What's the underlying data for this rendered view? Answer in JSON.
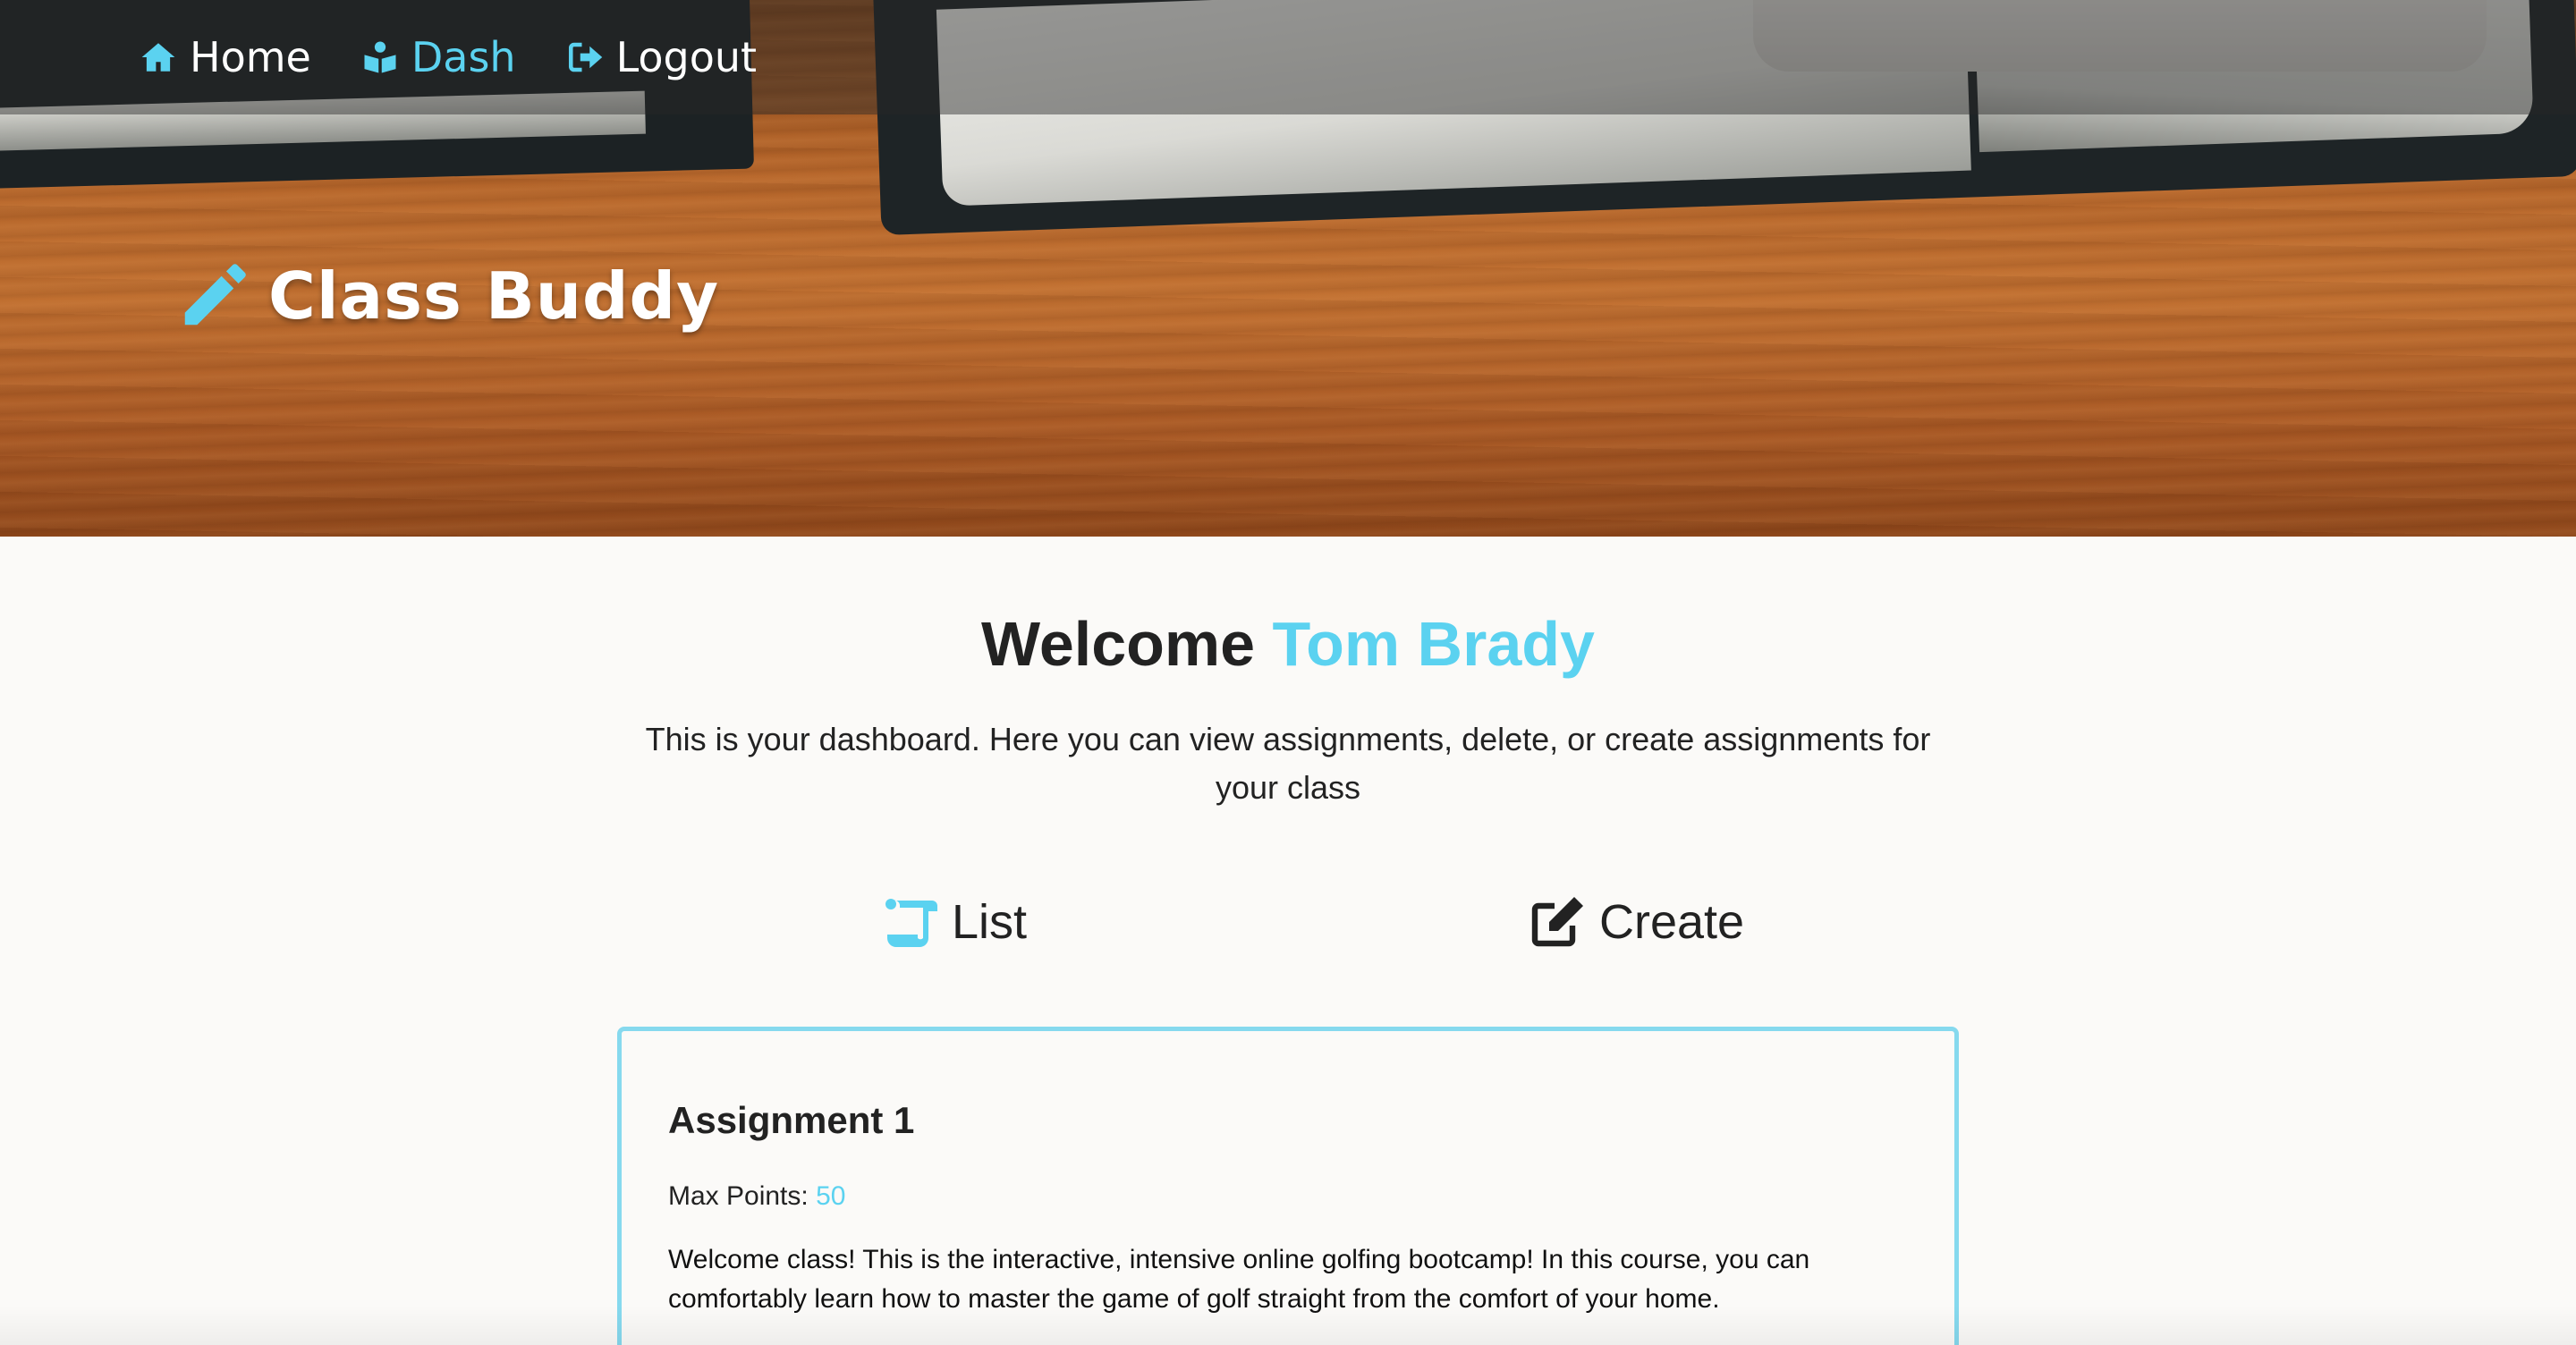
{
  "nav": {
    "items": [
      {
        "label": "Home",
        "icon": "home-icon"
      },
      {
        "label": "Dash",
        "icon": "dashboard-user-icon",
        "active": true
      },
      {
        "label": "Logout",
        "icon": "logout-icon"
      }
    ]
  },
  "brand": {
    "title": "Class Buddy",
    "icon": "pencil-icon"
  },
  "welcome": {
    "prefix": "Welcome",
    "name": "Tom Brady"
  },
  "intro": "This is your dashboard. Here you can view assignments, delete, or create assignments for your class",
  "tabs": {
    "list": {
      "label": "List",
      "icon": "scroll-icon"
    },
    "create": {
      "label": "Create",
      "icon": "edit-icon"
    }
  },
  "assignment": {
    "title": "Assignment 1",
    "max_points_label": "Max Points:",
    "max_points": "50",
    "description": "Welcome class! This is the interactive, intensive online golfing bootcamp! In this course, you can comfortably learn how to master the game of golf straight from the comfort of your home."
  },
  "colors": {
    "accent": "#5bd2f0",
    "card_border": "#86d9ee",
    "background": "#fbfaf8"
  }
}
